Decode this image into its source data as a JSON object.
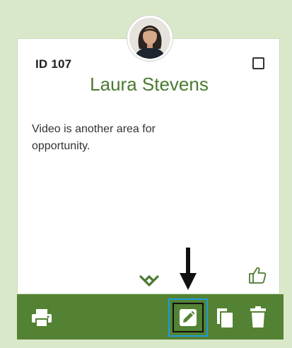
{
  "card": {
    "id_label": "ID 107",
    "name": "Laura Stevens",
    "body": "Video is another area for opportunity."
  },
  "icons": {
    "avatar": "profile-photo",
    "checkbox": "square-checkbox",
    "expand": "chevron-double-down-icon",
    "like": "thumbs-up-icon",
    "print": "printer-icon",
    "edit": "pencil-icon",
    "copy": "copy-icon",
    "delete": "trash-icon",
    "indicator": "arrow-down-icon"
  },
  "colors": {
    "background": "#d9e8c9",
    "brand_green": "#548234",
    "name_green": "#4b7a31",
    "highlight_blue": "#1d9bdb"
  }
}
